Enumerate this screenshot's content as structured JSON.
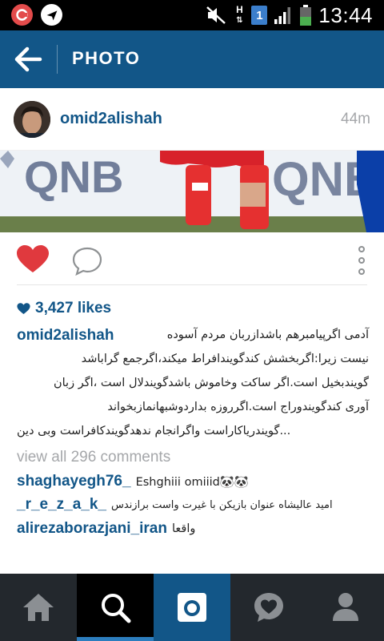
{
  "status_bar": {
    "time": "13:44",
    "sim_number": "1",
    "data_indicator": "H",
    "colors": {
      "app1": "#e34b4b",
      "battery": "#4caf50"
    }
  },
  "header": {
    "title": "PHOTO",
    "background": "#125688"
  },
  "post": {
    "username": "omid2alishah",
    "time_ago": "44m",
    "likes": "3,427 likes",
    "caption_lines": [
      "آدمی اگرپیامبرهم باشدازربان مردم آسوده",
      "نیست زیرا:اگربخشش کندگویندافراط میکند،اگرجمع گراباشد",
      "گویندبخیل است.اگر ساکت وخاموش باشدگویندلال است ،اگر زبان",
      "آوری کندگویندوراج است.اگرروزه بداردوشبهانمازبخواند",
      "...گویندریاکاراست واگرانجام ندهدگویندکافراست وبی دین"
    ],
    "view_all": "view all 296 comments",
    "comments": [
      {
        "user": "shaghayegh76_",
        "text": "Eshghiii omiiid🐼🐼"
      },
      {
        "user": "_r_e_z_a_k_",
        "text": "امید عالیشاه عنوان بازیکن با غیرت واست برازندس"
      },
      {
        "user": "alirezaborazjani_iran",
        "text": "واقعا"
      }
    ],
    "photo_text": "QNB QNB"
  },
  "colors": {
    "link_blue": "#125688",
    "heart_red": "#e0393e",
    "gray_text": "#a5a7aa",
    "nav_bg": "#23282d",
    "nav_active": "#2c7dbe"
  },
  "icons": {
    "back": "arrow-left-icon",
    "like": "heart-icon",
    "comment": "speech-bubble-icon",
    "more": "vertical-dots-icon",
    "nav": [
      "home-icon",
      "search-icon",
      "camera-icon",
      "activity-heart-icon",
      "profile-icon"
    ]
  }
}
